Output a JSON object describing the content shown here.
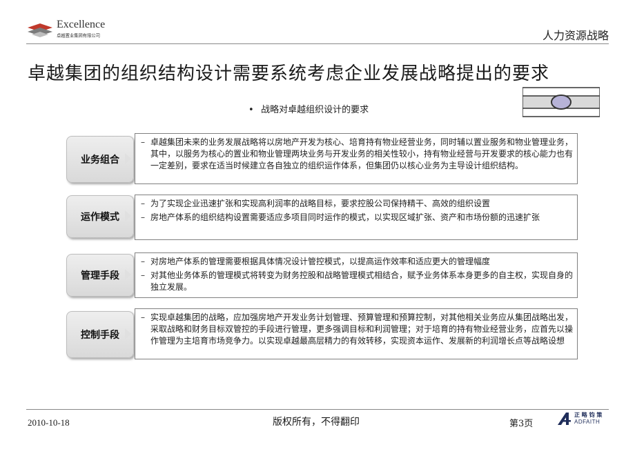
{
  "header": {
    "logo_word": "Excellence",
    "logo_sub": "卓越置业集团有限公司",
    "section_title": "人力资源战略"
  },
  "title": "卓越集团的组织结构设计需要系统考虑企业发展战略提出的要求",
  "subheading": {
    "bullet": "•",
    "text": "战略对卓越组织设计的要求"
  },
  "rows": [
    {
      "label": "业务组合",
      "items": [
        "卓越集团未来的业务发展战略将以房地产开发为核心、培育持有物业经营业务，同时辅以置业服务和物业管理业务，其中，以服务为核心的置业和物业管理两块业务与开发业务的相关性较小，持有物业经营与开发要求的核心能力也有一定差别，要求在适当时候建立各自独立的组织运作体系，但集团仍以核心业务为主导设计组织结构。"
      ]
    },
    {
      "label": "运作模式",
      "items": [
        "为了实现企业迅速扩张和实现高利润率的战略目标，要求控股公司保持精干、高效的组织设置",
        "房地产体系的组织结构设置需要适应多项目同时运作的模式，以实现区域扩张、资产和市场份额的迅速扩张"
      ]
    },
    {
      "label": "管理手段",
      "items": [
        "对房地产体系的管理需要根据具体情况设计管控模式，以提高运作效率和适应更大的管理幅度",
        "对其他业务体系的管理模式将转变为财务控股和战略管理模式相结合，赋予业务体系本身更多的自主权，实现自身的独立发展。"
      ]
    },
    {
      "label": "控制手段",
      "items": [
        "实现卓越集团的战略，应加强房地产开发业务计划管理、预算管理和预算控制，对其他相关业务应从集团战略出发，采取战略和财务目标双管控的手段进行管理，更多强调目标和利润管理；对于培育的持有物业经营业务，应首先以操作管理为主培育市场竞争力。以实现卓越最高层精力的有效转移，实现资本运作、发展新的利润增长点等战略设想"
      ]
    }
  ],
  "dash": "–",
  "footer": {
    "date": "2010-10-18",
    "copyright": "版权所有，不得翻印",
    "page": "第3页",
    "logo_cn": "正 略 钧 策",
    "logo_en": "ADFAITH"
  }
}
